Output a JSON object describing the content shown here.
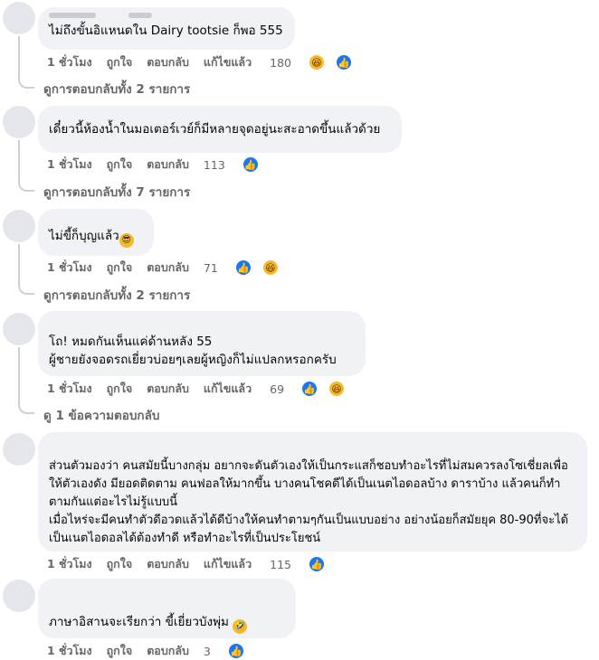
{
  "comments": [
    {
      "text": "ไม่ถึงขั้นอิแหนดใน Dairy tootsie ก็พอ 555",
      "time": "1 ชั่วโมง",
      "like": "ถูกใจ",
      "reply": "ตอบกลับ",
      "edited": "แก้ไขแล้ว",
      "reactions": "180",
      "replies": "ดูการตอบกลับทั้ง 2 รายการ"
    },
    {
      "text": "เดี๋ยวนี้ห้องน้ำในมอเตอร์เวย์ก็มีหลายจุดอยู่นะสะอาดขึ้นแล้วด้วย",
      "time": "1 ชั่วโมง",
      "like": "ถูกใจ",
      "reply": "ตอบกลับ",
      "reactions": "113",
      "replies": "ดูการตอบกลับทั้ง 7 รายการ"
    },
    {
      "text": "ไม่ขี้ก็บุญแล้ว",
      "emoji": "😎",
      "time": "1 ชั่วโมง",
      "like": "ถูกใจ",
      "reply": "ตอบกลับ",
      "reactions": "71",
      "replies": "ดูการตอบกลับทั้ง 2 รายการ"
    },
    {
      "text": "โถ! หมดกันเห็นแค่ด้านหลัง 55\nผู้ชายยังจอดรถเยี่ยวบ่อยๆเลยผู้หญิงก็ไม่แปลกหรอกครับ",
      "time": "1 ชั่วโมง",
      "like": "ถูกใจ",
      "reply": "ตอบกลับ",
      "edited": "แก้ไขแล้ว",
      "reactions": "69",
      "replies": "ดู 1 ข้อความตอบกลับ"
    },
    {
      "text": "ส่วนตัวมองว่า คนสมัยนี้บางกลุ่ม อยากจะดันตัวเองให้เป็นกระแสก็ชอบทำอะไรที่ไม่สมควรลงโซเชี่ยลเพื่อให้ตัวเองดัง มียอดติดตาม คนฟอลให้มากขึ้น บางคนโชคดีได้เป็นเนตไอดอลบ้าง ดาราบ้าง แล้วคนก็ทำตามกันแต่อะไรไม่รู้แบบนี้\nเมื่อไหร่จะมีคนทำตัวดีอวดแล้วได้ดีบ้างให้คนทำตามๆกันเป็นแบบอย่าง อย่างน้อยก็สมัยยุค 80-90ที่จะได้เป็นเนตไอดอลได้ต้องทำดี หรือทำอะไรที่เป็นประโยชน์",
      "time": "1 ชั่วโมง",
      "like": "ถูกใจ",
      "reply": "ตอบกลับ",
      "edited": "แก้ไขแล้ว",
      "reactions": "115"
    },
    {
      "text": "ภาษาอิสานจะเรียกว่า ขี้เยี่ยวบังพุ่ม",
      "emoji": "🤣",
      "time": "1 ชั่วโมง",
      "like": "ถูกใจ",
      "reply": "ตอบกลับ",
      "reactions": "3"
    }
  ],
  "icons": {
    "like": "like-icon",
    "haha": "haha-icon",
    "cool": "sunglasses-emoji"
  },
  "colors": {
    "bubble": "#f0f2f5",
    "meta": "#65676b",
    "like": "#1877f2",
    "haha": "#f7b928"
  }
}
